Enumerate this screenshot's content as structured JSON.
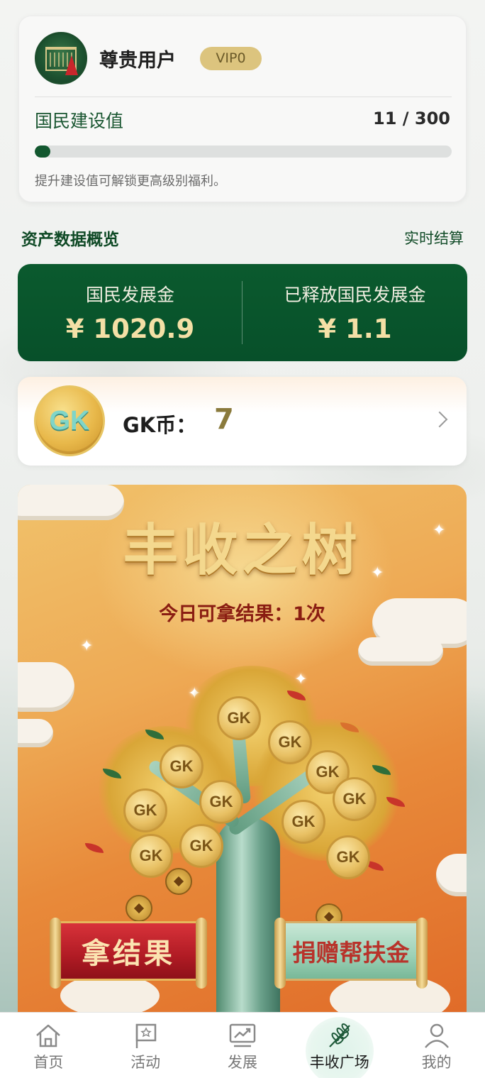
{
  "user": {
    "name": "尊贵用户",
    "vip": "VIP0",
    "score_label": "国民建设值",
    "score_text": "11 / 300",
    "score_current": 11,
    "score_max": 300,
    "hint": "提升建设值可解锁更高级别福利。"
  },
  "assets_section": {
    "title": "资产数据概览",
    "link": "实时结算"
  },
  "assets": {
    "left_label": "国民发展金",
    "left_value": "¥ 1020.9",
    "right_label": "已释放国民发展金",
    "right_value": "¥ 1.1"
  },
  "coin": {
    "icon_text": "GK",
    "label": "GK币：",
    "value": "7"
  },
  "banner": {
    "title": "丰收之树",
    "subtitle": "今日可拿结果：1次",
    "harvest_button": "拿结果",
    "donate_button": "捐赠帮扶金",
    "coin_text": "GK"
  },
  "tabs": [
    {
      "label": "首页",
      "icon": "home-icon"
    },
    {
      "label": "活动",
      "icon": "flag-icon"
    },
    {
      "label": "发展",
      "icon": "chart-icon"
    },
    {
      "label": "丰收广场",
      "icon": "wheat-icon"
    },
    {
      "label": "我的",
      "icon": "user-icon"
    }
  ],
  "colors": {
    "primary_green": "#0b5a2e",
    "gold": "#dcc47e",
    "coin_value": "#8a7a3c"
  }
}
